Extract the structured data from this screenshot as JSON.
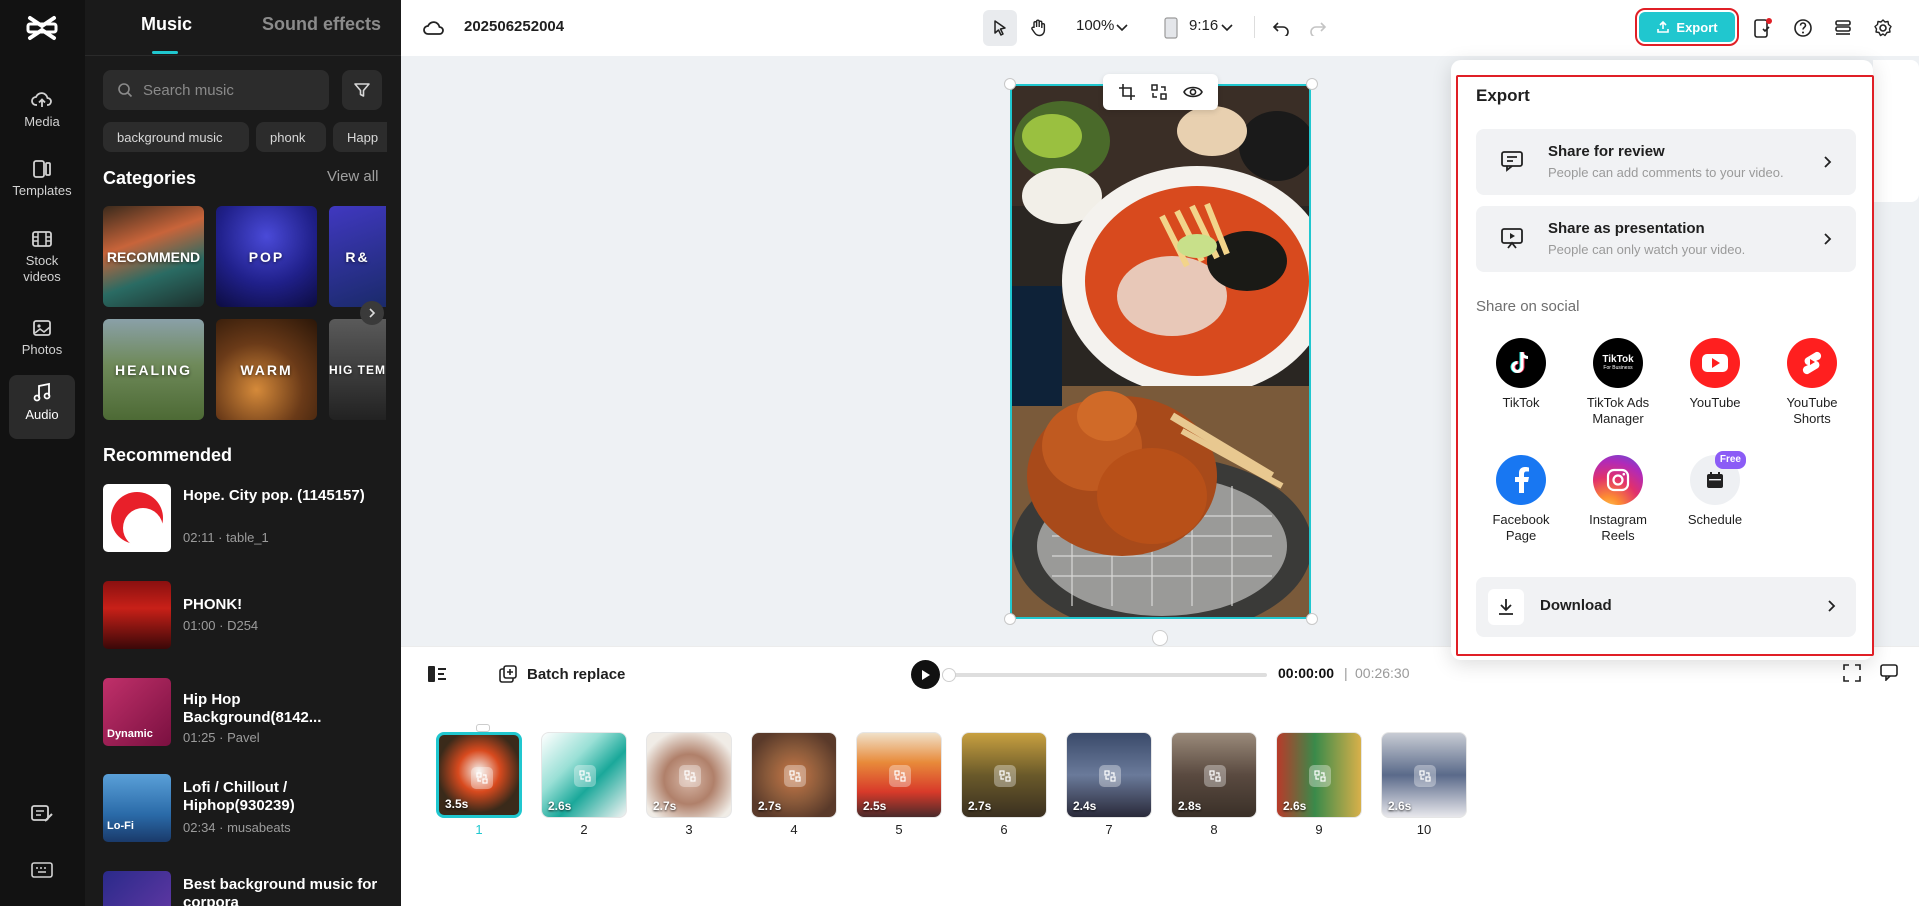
{
  "rail": {
    "items": [
      {
        "label": "Media",
        "icon": "cloud-upload-icon"
      },
      {
        "label": "Templates",
        "icon": "template-icon"
      },
      {
        "label": "Stock videos",
        "icon": "film-icon"
      },
      {
        "label": "Photos",
        "icon": "image-icon"
      },
      {
        "label": "Audio",
        "icon": "music-note-icon"
      }
    ],
    "active": "Audio"
  },
  "panel": {
    "tabs": [
      "Music",
      "Sound effects"
    ],
    "active_tab": "Music",
    "search_placeholder": "Search music",
    "chips": [
      "background music",
      "phonk",
      "Happ"
    ],
    "categories_title": "Categories",
    "view_all": "View all",
    "categories": [
      "RECOMMEND",
      "POP",
      "R&",
      "HEALING",
      "WARM",
      "HIG TEM"
    ],
    "recommended_title": "Recommended",
    "tracks": [
      {
        "title": "Hope. City pop. (1145157)",
        "meta": "02:11 · table_1"
      },
      {
        "title": "PHONK!",
        "meta": "01:00 · D254"
      },
      {
        "title": "Hip Hop Background(8142...",
        "meta": "01:25 · Pavel",
        "thumb_label": "Dynamic"
      },
      {
        "title": "Lofi / Chillout / Hiphop(930239)",
        "meta": "02:34 · musabeats",
        "thumb_label": "Lo-Fi"
      },
      {
        "title": "Best background music for corpora",
        "meta": ""
      }
    ]
  },
  "topbar": {
    "project_name": "202506252004",
    "zoom": "100%",
    "aspect": "9:16",
    "export_label": "Export"
  },
  "playback": {
    "batch_replace": "Batch replace",
    "current_time": "00:00:00",
    "separator": "|",
    "total_time": "00:26:30",
    "progress": 0
  },
  "timeline": {
    "clips": [
      {
        "num": "1",
        "dur": "3.5s"
      },
      {
        "num": "2",
        "dur": "2.6s"
      },
      {
        "num": "3",
        "dur": "2.7s"
      },
      {
        "num": "4",
        "dur": "2.7s"
      },
      {
        "num": "5",
        "dur": "2.5s"
      },
      {
        "num": "6",
        "dur": "2.7s"
      },
      {
        "num": "7",
        "dur": "2.4s"
      },
      {
        "num": "8",
        "dur": "2.8s"
      },
      {
        "num": "9",
        "dur": "2.6s"
      },
      {
        "num": "10",
        "dur": "2.6s"
      }
    ],
    "selected": "1"
  },
  "export_panel": {
    "title": "Export",
    "share_review": {
      "title": "Share for review",
      "sub": "People can add comments to your video."
    },
    "share_presentation": {
      "title": "Share as presentation",
      "sub": "People can only watch your video."
    },
    "social_title": "Share on social",
    "social": [
      {
        "label": "TikTok",
        "icon": "tiktok-icon"
      },
      {
        "label": "TikTok Ads Manager",
        "icon": "tiktok-ads-icon",
        "logo_text": "TikTok",
        "logo_sub": "For Business"
      },
      {
        "label": "YouTube",
        "icon": "youtube-icon"
      },
      {
        "label": "YouTube Shorts",
        "icon": "youtube-shorts-icon"
      },
      {
        "label": "Facebook Page",
        "icon": "facebook-icon"
      },
      {
        "label": "Instagram Reels",
        "icon": "instagram-icon"
      },
      {
        "label": "Schedule",
        "icon": "calendar-icon",
        "badge": "Free"
      }
    ],
    "download": "Download"
  },
  "colors": {
    "accent": "#20c7cf",
    "highlight": "#e01f26",
    "rail_bg": "#121212",
    "panel_bg": "#1a1a1a"
  }
}
